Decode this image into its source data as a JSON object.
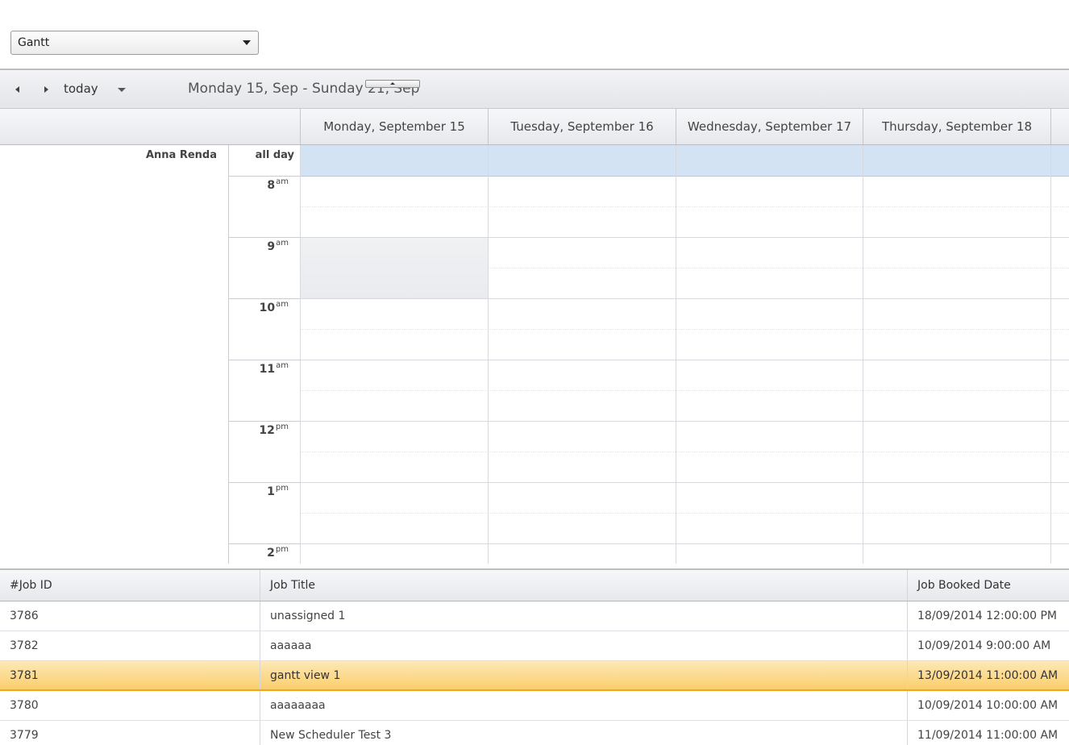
{
  "view_select": {
    "value": "Gantt"
  },
  "toolbar": {
    "today_label": "today",
    "date_range": "Monday 15, Sep - Sunday 21, Sep"
  },
  "days": [
    "Monday, September 15",
    "Tuesday, September 16",
    "Wednesday, September 17",
    "Thursday, September 18"
  ],
  "resource": {
    "name": "Anna Renda"
  },
  "time_col": {
    "all_day": "all day",
    "hours": [
      {
        "h": "8",
        "suffix": "am"
      },
      {
        "h": "9",
        "suffix": "am"
      },
      {
        "h": "10",
        "suffix": "am"
      },
      {
        "h": "11",
        "suffix": "am"
      },
      {
        "h": "12",
        "suffix": "pm"
      },
      {
        "h": "1",
        "suffix": "pm"
      },
      {
        "h": "2",
        "suffix": "pm"
      }
    ]
  },
  "jobs": {
    "headers": {
      "id": "#Job ID",
      "title": "Job Title",
      "booked": "Job Booked Date"
    },
    "rows": [
      {
        "id": "3786",
        "title": "unassigned 1",
        "booked": "18/09/2014 12:00:00 PM",
        "selected": false
      },
      {
        "id": "3782",
        "title": "aaaaaa",
        "booked": "10/09/2014 9:00:00 AM",
        "selected": false
      },
      {
        "id": "3781",
        "title": "gantt view 1",
        "booked": "13/09/2014 11:00:00 AM",
        "selected": true
      },
      {
        "id": "3780",
        "title": "aaaaaaaa",
        "booked": "10/09/2014 10:00:00 AM",
        "selected": false
      },
      {
        "id": "3779",
        "title": "New Scheduler Test 3",
        "booked": "11/09/2014 11:00:00 AM",
        "selected": false
      }
    ]
  },
  "colors": {
    "allday_bg": "#d4e3f4",
    "selected_row": "#fbce6c",
    "nonwork_slot": "#e9ebef"
  }
}
